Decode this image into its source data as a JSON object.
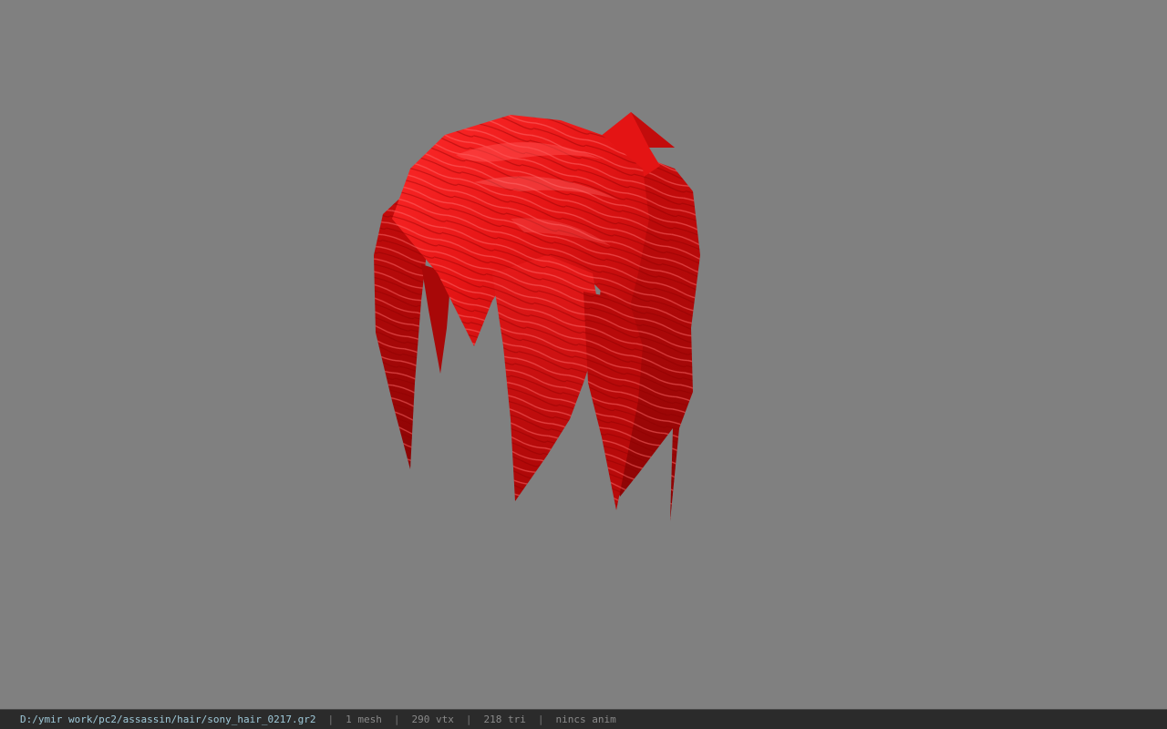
{
  "viewer": {
    "background_color": "#808080",
    "model_color": "#e01010"
  },
  "statusbar": {
    "path": "D:/ymir work/pc2/assassin/hair/sony_hair_0217.gr2",
    "separator": "|",
    "mesh_count": "1 mesh",
    "vertex_count": "290 vtx",
    "triangle_count": "218 tri",
    "anim_status": "nincs anim"
  }
}
